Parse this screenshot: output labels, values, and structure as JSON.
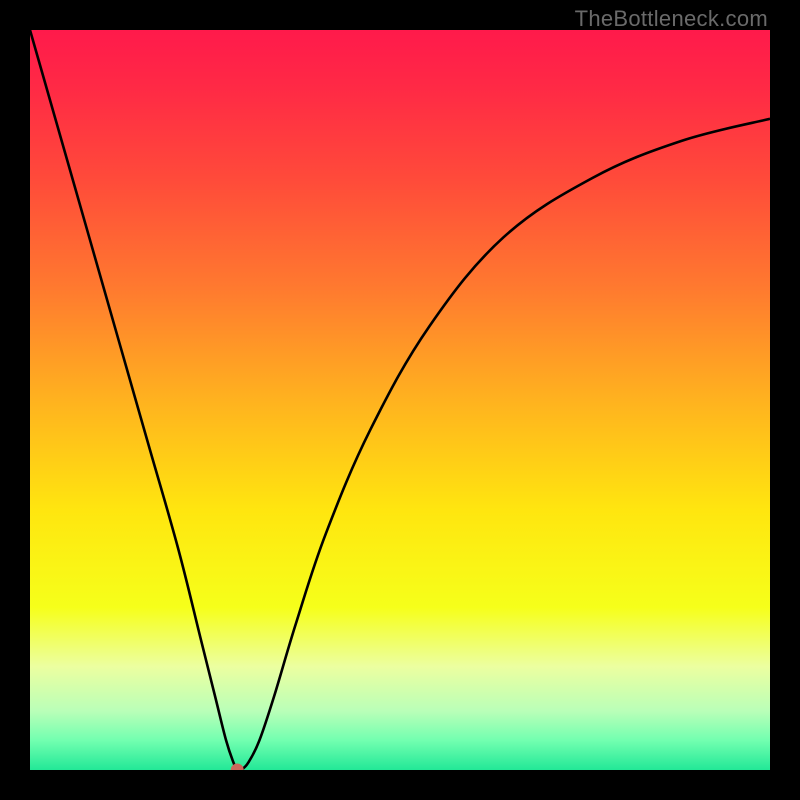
{
  "watermark": "TheBottleneck.com",
  "colors": {
    "frame": "#000000",
    "curve": "#000000",
    "dot": "#ca695c",
    "gradient_stops": [
      {
        "offset": 0.0,
        "color": "#ff1a4b"
      },
      {
        "offset": 0.08,
        "color": "#ff2a45"
      },
      {
        "offset": 0.2,
        "color": "#ff4a3a"
      },
      {
        "offset": 0.35,
        "color": "#ff7a2f"
      },
      {
        "offset": 0.5,
        "color": "#ffb21f"
      },
      {
        "offset": 0.65,
        "color": "#ffe60f"
      },
      {
        "offset": 0.78,
        "color": "#f6ff1a"
      },
      {
        "offset": 0.86,
        "color": "#ecffa0"
      },
      {
        "offset": 0.92,
        "color": "#baffb8"
      },
      {
        "offset": 0.96,
        "color": "#72ffb0"
      },
      {
        "offset": 1.0,
        "color": "#22e897"
      }
    ]
  },
  "chart_data": {
    "type": "line",
    "title": "",
    "xlabel": "",
    "ylabel": "",
    "xlim": [
      0,
      100
    ],
    "ylim": [
      0,
      100
    ],
    "grid": false,
    "note": "V-shaped bottleneck curve. y is percent bottleneck (0 at green bottom, 100 at red top). Minimum near x≈28.",
    "series": [
      {
        "name": "bottleneck-curve",
        "x": [
          0,
          4,
          8,
          12,
          16,
          20,
          23,
          25,
          26.5,
          27.5,
          28,
          28.5,
          29.5,
          31,
          33,
          36,
          40,
          46,
          54,
          64,
          76,
          88,
          100
        ],
        "y": [
          100,
          86,
          72,
          58,
          44,
          30,
          18,
          10,
          4,
          1,
          0,
          0,
          1,
          4,
          10,
          20,
          32,
          46,
          60,
          72,
          80,
          85,
          88
        ]
      }
    ],
    "annotations": [
      {
        "name": "min-dot",
        "x": 28,
        "y": 0
      }
    ]
  }
}
